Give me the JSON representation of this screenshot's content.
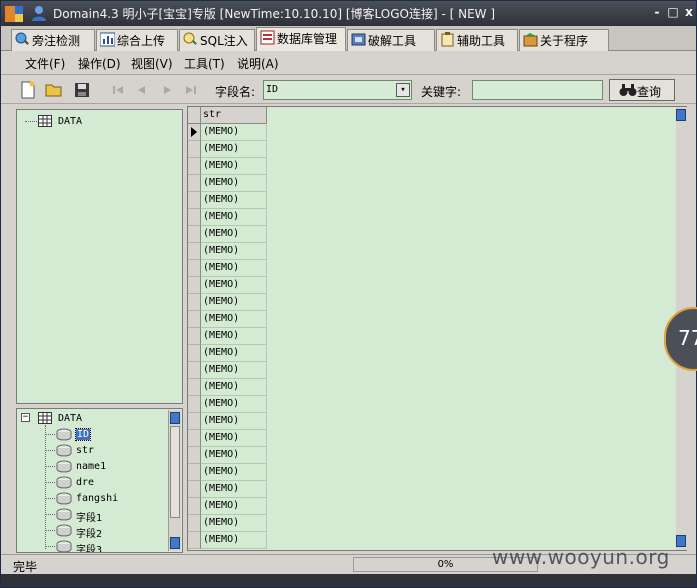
{
  "window": {
    "title": "Domain4.3 明小子[宝宝]专版 [NewTime:10.10.10] [博客LOGO连接]  - [ NEW ]",
    "controls": [
      "-",
      "□",
      "x"
    ]
  },
  "tabs": [
    {
      "label": "旁注检测",
      "icon": "magnifier-globe-icon"
    },
    {
      "label": "综合上传",
      "icon": "chart-icon"
    },
    {
      "label": "SQL注入",
      "icon": "search-icon"
    },
    {
      "label": "数据库管理",
      "icon": "database-icon",
      "active": true
    },
    {
      "label": "破解工具",
      "icon": "crack-tool-icon"
    },
    {
      "label": "辅助工具",
      "icon": "clipboard-icon"
    },
    {
      "label": "关于程序",
      "icon": "info-icon"
    }
  ],
  "menu": [
    "文件(F)",
    "操作(D)",
    "视图(V)",
    "工具(T)",
    "说明(A)"
  ],
  "toolbar": {
    "field_label": "字段名:",
    "field_value": "ID",
    "keyword_label": "关键字:",
    "keyword_value": "",
    "query_label": "查询"
  },
  "tree_top": {
    "root": "DATA"
  },
  "tree_bottom": {
    "root": "DATA",
    "fields": [
      "ID",
      "str",
      "name1",
      "dre",
      "fangshi",
      "字段1",
      "字段2",
      "字段3"
    ],
    "selected": "ID"
  },
  "grid": {
    "column": "str",
    "rows": [
      "(MEMO)",
      "(MEMO)",
      "(MEMO)",
      "(MEMO)",
      "(MEMO)",
      "(MEMO)",
      "(MEMO)",
      "(MEMO)",
      "(MEMO)",
      "(MEMO)",
      "(MEMO)",
      "(MEMO)",
      "(MEMO)",
      "(MEMO)",
      "(MEMO)",
      "(MEMO)",
      "(MEMO)",
      "(MEMO)",
      "(MEMO)",
      "(MEMO)",
      "(MEMO)",
      "(MEMO)",
      "(MEMO)",
      "(MEMO)",
      "(MEMO)"
    ]
  },
  "status": {
    "text": "完毕",
    "progress": "0%"
  },
  "watermark": "www.wooyun.org",
  "float_widget": "77",
  "colors": {
    "panel_bg": "#d4ead3",
    "titlebar": "#2e3138",
    "accent_blue": "#3f78c8"
  }
}
